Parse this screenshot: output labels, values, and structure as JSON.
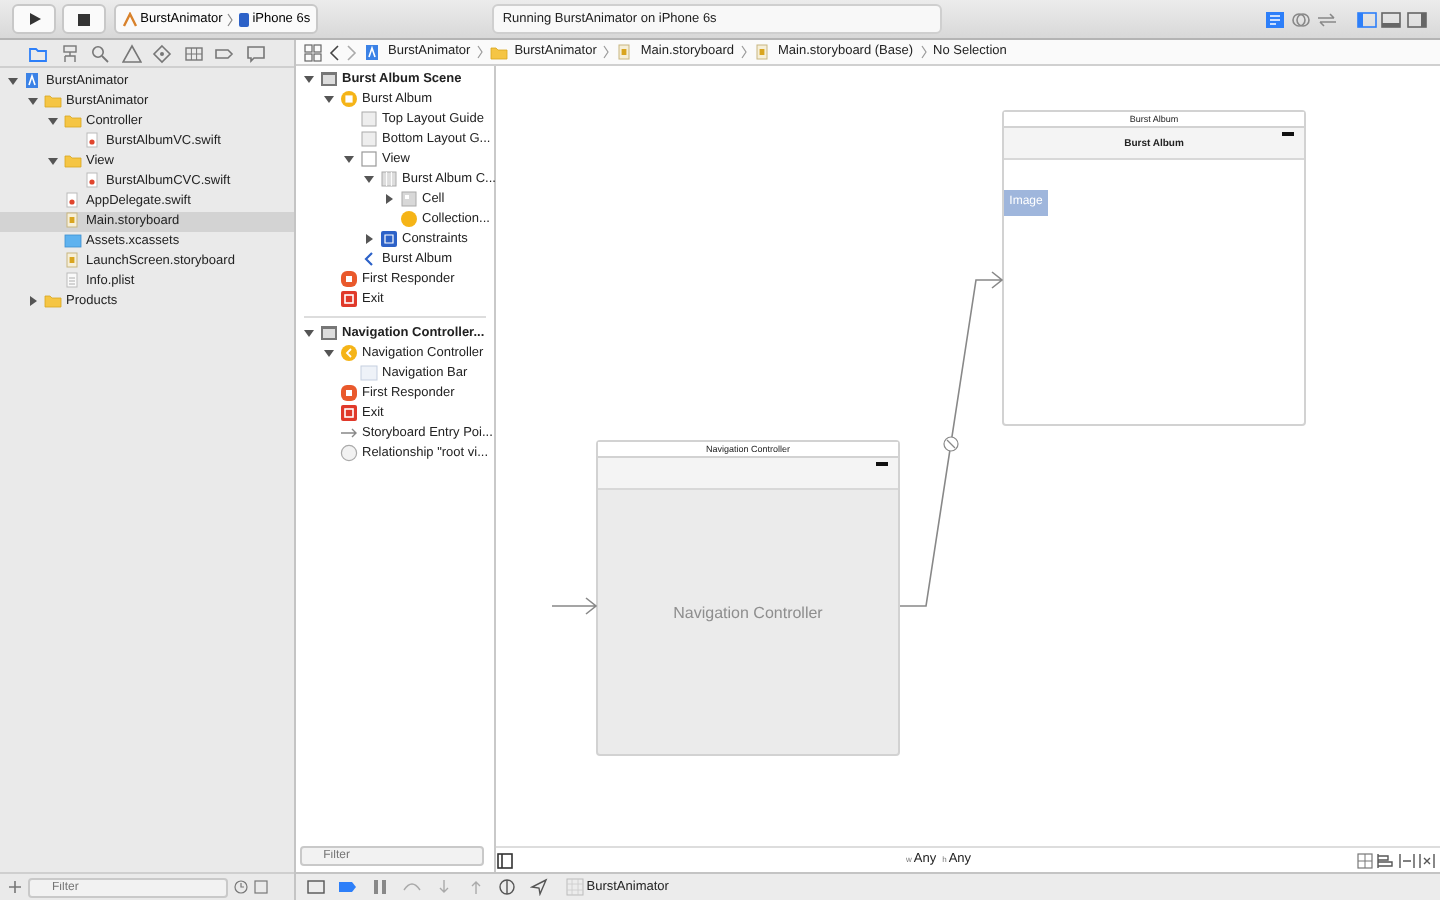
{
  "toolbar": {
    "scheme": "BurstAnimator",
    "device": "iPhone 6s",
    "activity": "Running BurstAnimator on iPhone 6s",
    "editor_modes": [
      {
        "kind": "standard",
        "selected": true
      },
      {
        "kind": "assistant",
        "selected": false
      },
      {
        "kind": "version",
        "selected": false
      }
    ],
    "panels": [
      {
        "kind": "left",
        "on": true
      },
      {
        "kind": "bottom",
        "on": false
      },
      {
        "kind": "right",
        "on": false
      }
    ]
  },
  "navigator": {
    "tabs": [
      {
        "kind": "folder",
        "selected": true
      },
      {
        "kind": "hierarchy",
        "selected": false
      },
      {
        "kind": "search",
        "selected": false
      },
      {
        "kind": "warning",
        "selected": false
      },
      {
        "kind": "diamond",
        "selected": false
      },
      {
        "kind": "grid",
        "selected": false
      },
      {
        "kind": "tag",
        "selected": false
      },
      {
        "kind": "bubble",
        "selected": false
      }
    ],
    "tree": [
      {
        "label": "BurstAnimator",
        "kind": "project",
        "selected": false,
        "expanded": true,
        "children": [
          {
            "label": "BurstAnimator",
            "kind": "folder",
            "selected": false,
            "expanded": true,
            "children": [
              {
                "label": "Controller",
                "kind": "folder",
                "selected": false,
                "expanded": true,
                "children": [
                  {
                    "label": "BurstAlbumVC.swift",
                    "kind": "swift",
                    "selected": false
                  }
                ]
              },
              {
                "label": "View",
                "kind": "folder",
                "selected": false,
                "expanded": true,
                "children": [
                  {
                    "label": "BurstAlbumCVC.swift",
                    "kind": "swift",
                    "selected": false
                  }
                ]
              },
              {
                "label": "AppDelegate.swift",
                "kind": "swift",
                "selected": false
              },
              {
                "label": "Main.storyboard",
                "kind": "storyboard",
                "selected": true
              },
              {
                "label": "Assets.xcassets",
                "kind": "assets",
                "selected": false
              },
              {
                "label": "LaunchScreen.storyboard",
                "kind": "storyboard",
                "selected": false
              },
              {
                "label": "Info.plist",
                "kind": "plist",
                "selected": false
              }
            ]
          },
          {
            "label": "Products",
            "kind": "folder",
            "selected": false,
            "expanded": false
          }
        ]
      }
    ],
    "filter": {
      "placeholder": "Filter"
    }
  },
  "breadcrumb": [
    {
      "label": "BurstAnimator",
      "kind": "project"
    },
    {
      "label": "BurstAnimator",
      "kind": "folder"
    },
    {
      "label": "Main.storyboard",
      "kind": "storyboard"
    },
    {
      "label": "Main.storyboard (Base)",
      "kind": "storyboard"
    },
    {
      "label": "No Selection",
      "kind": "none"
    }
  ],
  "outline": {
    "scenes": [
      {
        "label": "Burst Album Scene",
        "kind": "scene",
        "expanded": true,
        "children": [
          {
            "label": "Burst Album",
            "kind": "vc",
            "expanded": true,
            "children": [
              {
                "label": "Top Layout Guide",
                "kind": "guide"
              },
              {
                "label": "Bottom Layout G...",
                "kind": "guide"
              },
              {
                "label": "View",
                "kind": "view",
                "expanded": true,
                "children": [
                  {
                    "label": "Burst Album C...",
                    "kind": "collection",
                    "expanded": true,
                    "children": [
                      {
                        "label": "Cell",
                        "kind": "cell",
                        "expanded": false
                      },
                      {
                        "label": "Collection...",
                        "kind": "object"
                      }
                    ]
                  },
                  {
                    "label": "Constraints",
                    "kind": "constraints",
                    "expanded": false
                  }
                ]
              },
              {
                "label": "Burst Album",
                "kind": "navitem"
              }
            ]
          },
          {
            "label": "First Responder",
            "kind": "responder"
          },
          {
            "label": "Exit",
            "kind": "exit"
          }
        ]
      },
      {
        "label": "Navigation Controller...",
        "kind": "scene",
        "expanded": true,
        "children": [
          {
            "label": "Navigation Controller",
            "kind": "nav",
            "expanded": true,
            "children": [
              {
                "label": "Navigation Bar",
                "kind": "navbar"
              }
            ]
          },
          {
            "label": "First Responder",
            "kind": "responder"
          },
          {
            "label": "Exit",
            "kind": "exit"
          },
          {
            "label": "Storyboard Entry Poi...",
            "kind": "entry"
          },
          {
            "label": "Relationship \"root vi...",
            "kind": "relationship"
          }
        ]
      }
    ],
    "filter": {
      "placeholder": "Filter"
    }
  },
  "canvas": {
    "scenes": [
      {
        "kind": "nav",
        "title": "Navigation Controller",
        "body_label": "Navigation Controller"
      },
      {
        "kind": "view",
        "title": "Burst Album",
        "nav_title": "Burst Album",
        "image_label": "Image"
      }
    ],
    "size_class": {
      "width_prefix": "w",
      "width": "Any",
      "height_prefix": "h",
      "height": "Any"
    }
  },
  "debug_bar": {
    "target": "BurstAnimator"
  }
}
